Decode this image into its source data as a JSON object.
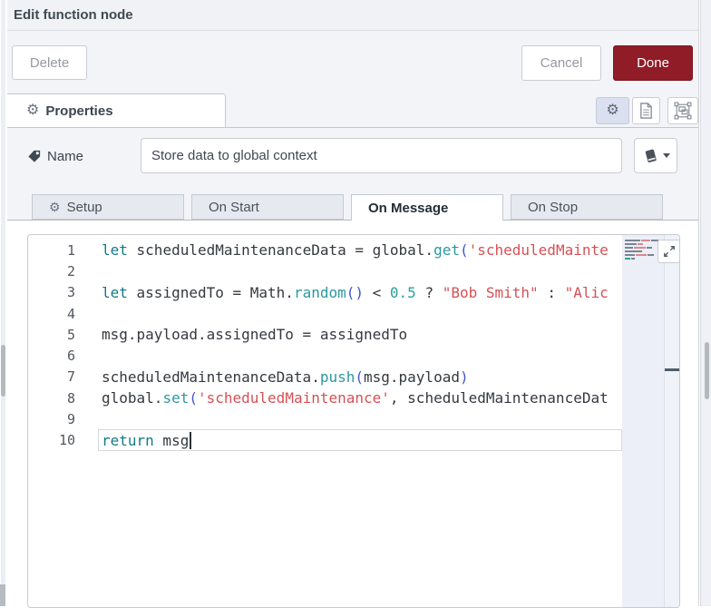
{
  "window": {
    "title": "Edit function node"
  },
  "toolbar": {
    "delete_label": "Delete",
    "cancel_label": "Cancel",
    "done_label": "Done"
  },
  "properties_tab": {
    "label": "Properties",
    "icon": "gear-icon"
  },
  "header_icon_buttons": [
    {
      "name": "gear-icon",
      "active": true
    },
    {
      "name": "document-icon",
      "active": false
    },
    {
      "name": "object-group-icon",
      "active": false
    }
  ],
  "name_field": {
    "label": "Name",
    "icon": "tag-icon",
    "value": "Store data to global context",
    "library_button_icon": "book-icon"
  },
  "function_tabs": [
    {
      "label": "Setup",
      "icon": "gear-icon",
      "active": false
    },
    {
      "label": "On Start",
      "active": false
    },
    {
      "label": "On Message",
      "active": true
    },
    {
      "label": "On Stop",
      "active": false
    }
  ],
  "editor": {
    "language_style": "javascript",
    "cursor": {
      "line": 10,
      "after_text": "return msg"
    },
    "lines": [
      {
        "n": "1",
        "tokens": [
          [
            "k",
            "let"
          ],
          [
            "d",
            " scheduledMaintenanceData = global."
          ],
          [
            "f",
            "get"
          ],
          [
            "p",
            "("
          ],
          [
            "s",
            "'scheduledMainte"
          ]
        ]
      },
      {
        "n": "2",
        "tokens": []
      },
      {
        "n": "3",
        "tokens": [
          [
            "k",
            "let"
          ],
          [
            "d",
            " assignedTo = Math."
          ],
          [
            "f",
            "random"
          ],
          [
            "p",
            "()"
          ],
          [
            "d",
            " < "
          ],
          [
            "n",
            "0.5"
          ],
          [
            "d",
            " ? "
          ],
          [
            "s",
            "\"Bob Smith\""
          ],
          [
            "d",
            " : "
          ],
          [
            "s",
            "\"Alic"
          ]
        ]
      },
      {
        "n": "4",
        "tokens": []
      },
      {
        "n": "5",
        "tokens": [
          [
            "d",
            "msg.payload.assignedTo = assignedTo"
          ]
        ]
      },
      {
        "n": "6",
        "tokens": []
      },
      {
        "n": "7",
        "tokens": [
          [
            "d",
            "scheduledMaintenanceData."
          ],
          [
            "f",
            "push"
          ],
          [
            "p",
            "("
          ],
          [
            "d",
            "msg.payload"
          ],
          [
            "p",
            ")"
          ]
        ]
      },
      {
        "n": "8",
        "tokens": [
          [
            "d",
            "global."
          ],
          [
            "f",
            "set"
          ],
          [
            "p",
            "("
          ],
          [
            "s",
            "'scheduledMaintenance'"
          ],
          [
            "d",
            ", scheduledMaintenanceDat"
          ]
        ]
      },
      {
        "n": "9",
        "tokens": []
      },
      {
        "n": "10",
        "tokens": [
          [
            "k",
            "return"
          ],
          [
            "d",
            " msg"
          ]
        ]
      }
    ]
  },
  "colors": {
    "done_button_bg": "#8f1c27",
    "keyword_teal": "#117a88",
    "method_teal": "#2b98a0",
    "string_red": "#d75055",
    "number_teal": "#2aa198",
    "paren_blue": "#4356c8",
    "dialog_bg": "#f3f4f8"
  }
}
